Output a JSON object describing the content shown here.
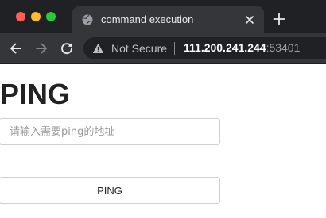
{
  "browser": {
    "tab": {
      "title": "command execution",
      "favicon_icon": "globe-icon",
      "close_icon": "close-icon"
    },
    "new_tab_icon": "plus-icon",
    "nav": {
      "back_icon": "arrow-left-icon",
      "forward_icon": "arrow-right-icon",
      "reload_icon": "reload-icon"
    },
    "address_bar": {
      "security_icon": "warning-icon",
      "security_label": "Not Secure",
      "host": "111.200.241.244",
      "port": ":53401"
    },
    "colors": {
      "tabstrip": "#202124",
      "toolbar": "#35363a",
      "traffic_red": "#fe5f57",
      "traffic_yellow": "#febc2e",
      "traffic_green": "#28c840"
    }
  },
  "page": {
    "title": "PING",
    "input": {
      "placeholder": "请输入需要ping的地址",
      "value": ""
    },
    "submit_button_label": "PING"
  }
}
